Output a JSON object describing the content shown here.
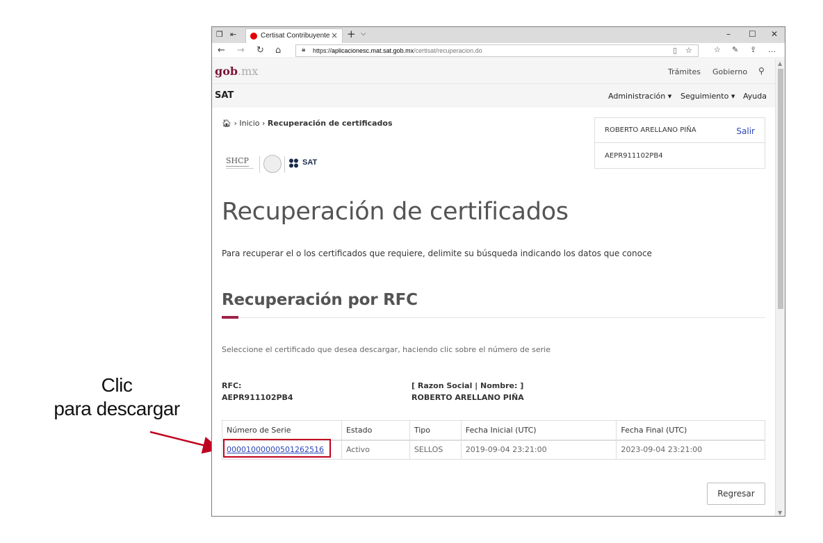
{
  "annotation": {
    "line1": "Clic",
    "line2": "para descargar"
  },
  "browser": {
    "tab_title": "Certisat Contribuyente",
    "url_prefix": "https://",
    "url_host": "aplicacionesc.mat.sat.gob.mx",
    "url_path": "/certisat/recuperacion.do"
  },
  "gob_bar": {
    "logo_main": "gob",
    "logo_suffix": ".mx",
    "tramites": "Trámites",
    "gobierno": "Gobierno"
  },
  "sat_bar": {
    "brand": "SAT",
    "menu": [
      "Administración",
      "Seguimiento",
      "Ayuda"
    ]
  },
  "breadcrumb": {
    "home": "Inicio",
    "current": "Recuperación de certificados"
  },
  "user": {
    "name": "ROBERTO ARELLANO PIÑA",
    "logout": "Salir",
    "rfc": "AEPR911102PB4"
  },
  "logos": {
    "shcp": "SHCP",
    "sat": "SAT"
  },
  "main": {
    "title": "Recuperación de certificados",
    "intro": "Para recuperar el o los certificados que requiere, delimite su búsqueda indicando los datos que conoce",
    "section_title": "Recuperación por RFC",
    "instruction": "Seleccione el certificado que desea descargar, haciendo clic sobre el número de serie",
    "rfc_label": "RFC:",
    "rfc_value": "AEPR911102PB4",
    "razon_label": "[ Razon Social | Nombre: ]",
    "razon_value": "ROBERTO ARELLANO PIÑA"
  },
  "table": {
    "headers": [
      "Número de Serie",
      "Estado",
      "Tipo",
      "Fecha Inicial (UTC)",
      "Fecha Final (UTC)"
    ],
    "rows": [
      {
        "serie": "00001000000501262516",
        "estado": "Activo",
        "tipo": "SELLOS",
        "inicial": "2019-09-04 23:21:00",
        "final": "2023-09-04 23:21:00"
      }
    ]
  },
  "back_button": "Regresar",
  "colors": {
    "accent": "#9d2449",
    "link": "#2b44b8",
    "highlight": "#c0001f",
    "gob": "#7a1634"
  }
}
